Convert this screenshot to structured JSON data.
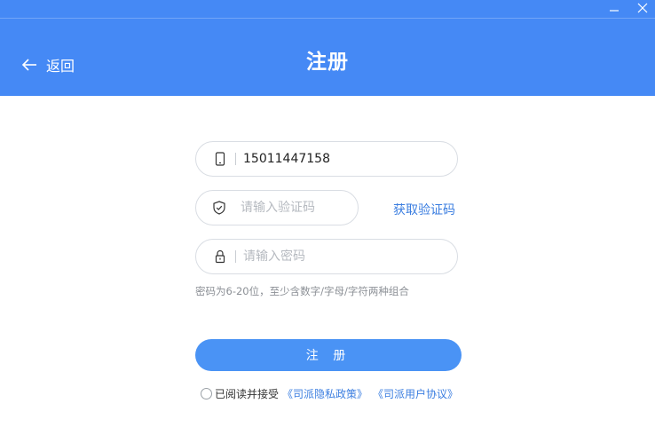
{
  "window": {
    "minimize_icon": "minimize-icon",
    "close_icon": "close-icon"
  },
  "header": {
    "back_label": "返回",
    "back_icon": "arrow-left-icon",
    "title": "注册",
    "color": "#4589f5"
  },
  "form": {
    "phone": {
      "value": "15011447158",
      "icon": "phone-icon"
    },
    "code": {
      "placeholder": "请输入验证码",
      "icon": "shield-icon",
      "action_label": "获取验证码"
    },
    "password": {
      "placeholder": "请输入密码",
      "icon": "lock-icon"
    },
    "hint": "密码为6-20位，至少含数字/字母/字符两种组合",
    "submit_label": "注 册"
  },
  "agreement": {
    "text": "已阅读并接受",
    "privacy_link": "《司派隐私政策》",
    "user_link": "《司派用户协议》"
  },
  "colors": {
    "accent": "#4a93f5",
    "link": "#3b7ee0"
  }
}
